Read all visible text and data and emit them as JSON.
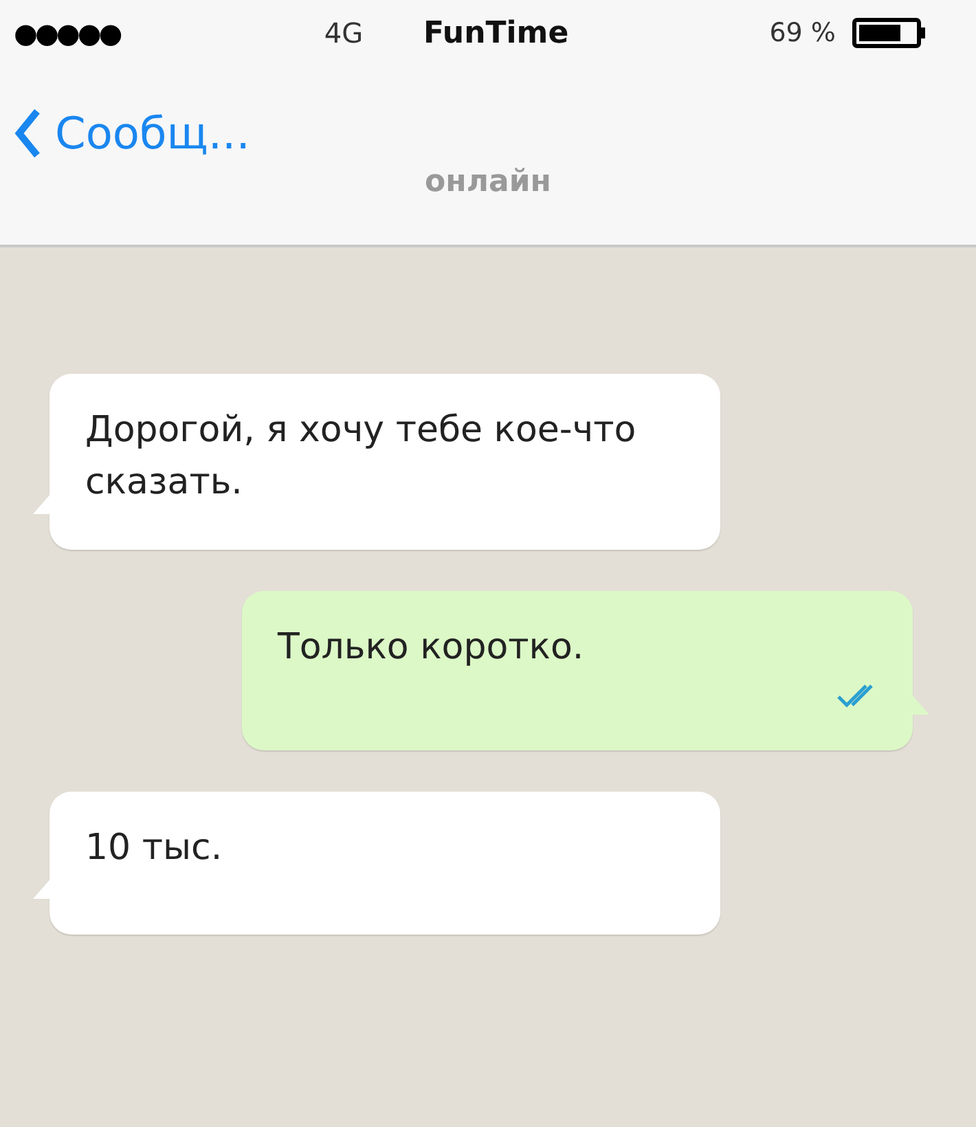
{
  "status_bar": {
    "signal_dots": "●●●●●",
    "network": "4G",
    "carrier": "FunTime",
    "battery": "69 %"
  },
  "nav": {
    "back": "Сообщ...",
    "status": "онлайн"
  },
  "messages": [
    {
      "kind": "incoming",
      "text": "Дорогой, я хочу тебе кое-что сказать.",
      "read": false
    },
    {
      "kind": "outgoing",
      "text": "Только коротко.",
      "read": true
    },
    {
      "kind": "incoming",
      "text": "10 тыс.",
      "read": false
    }
  ]
}
